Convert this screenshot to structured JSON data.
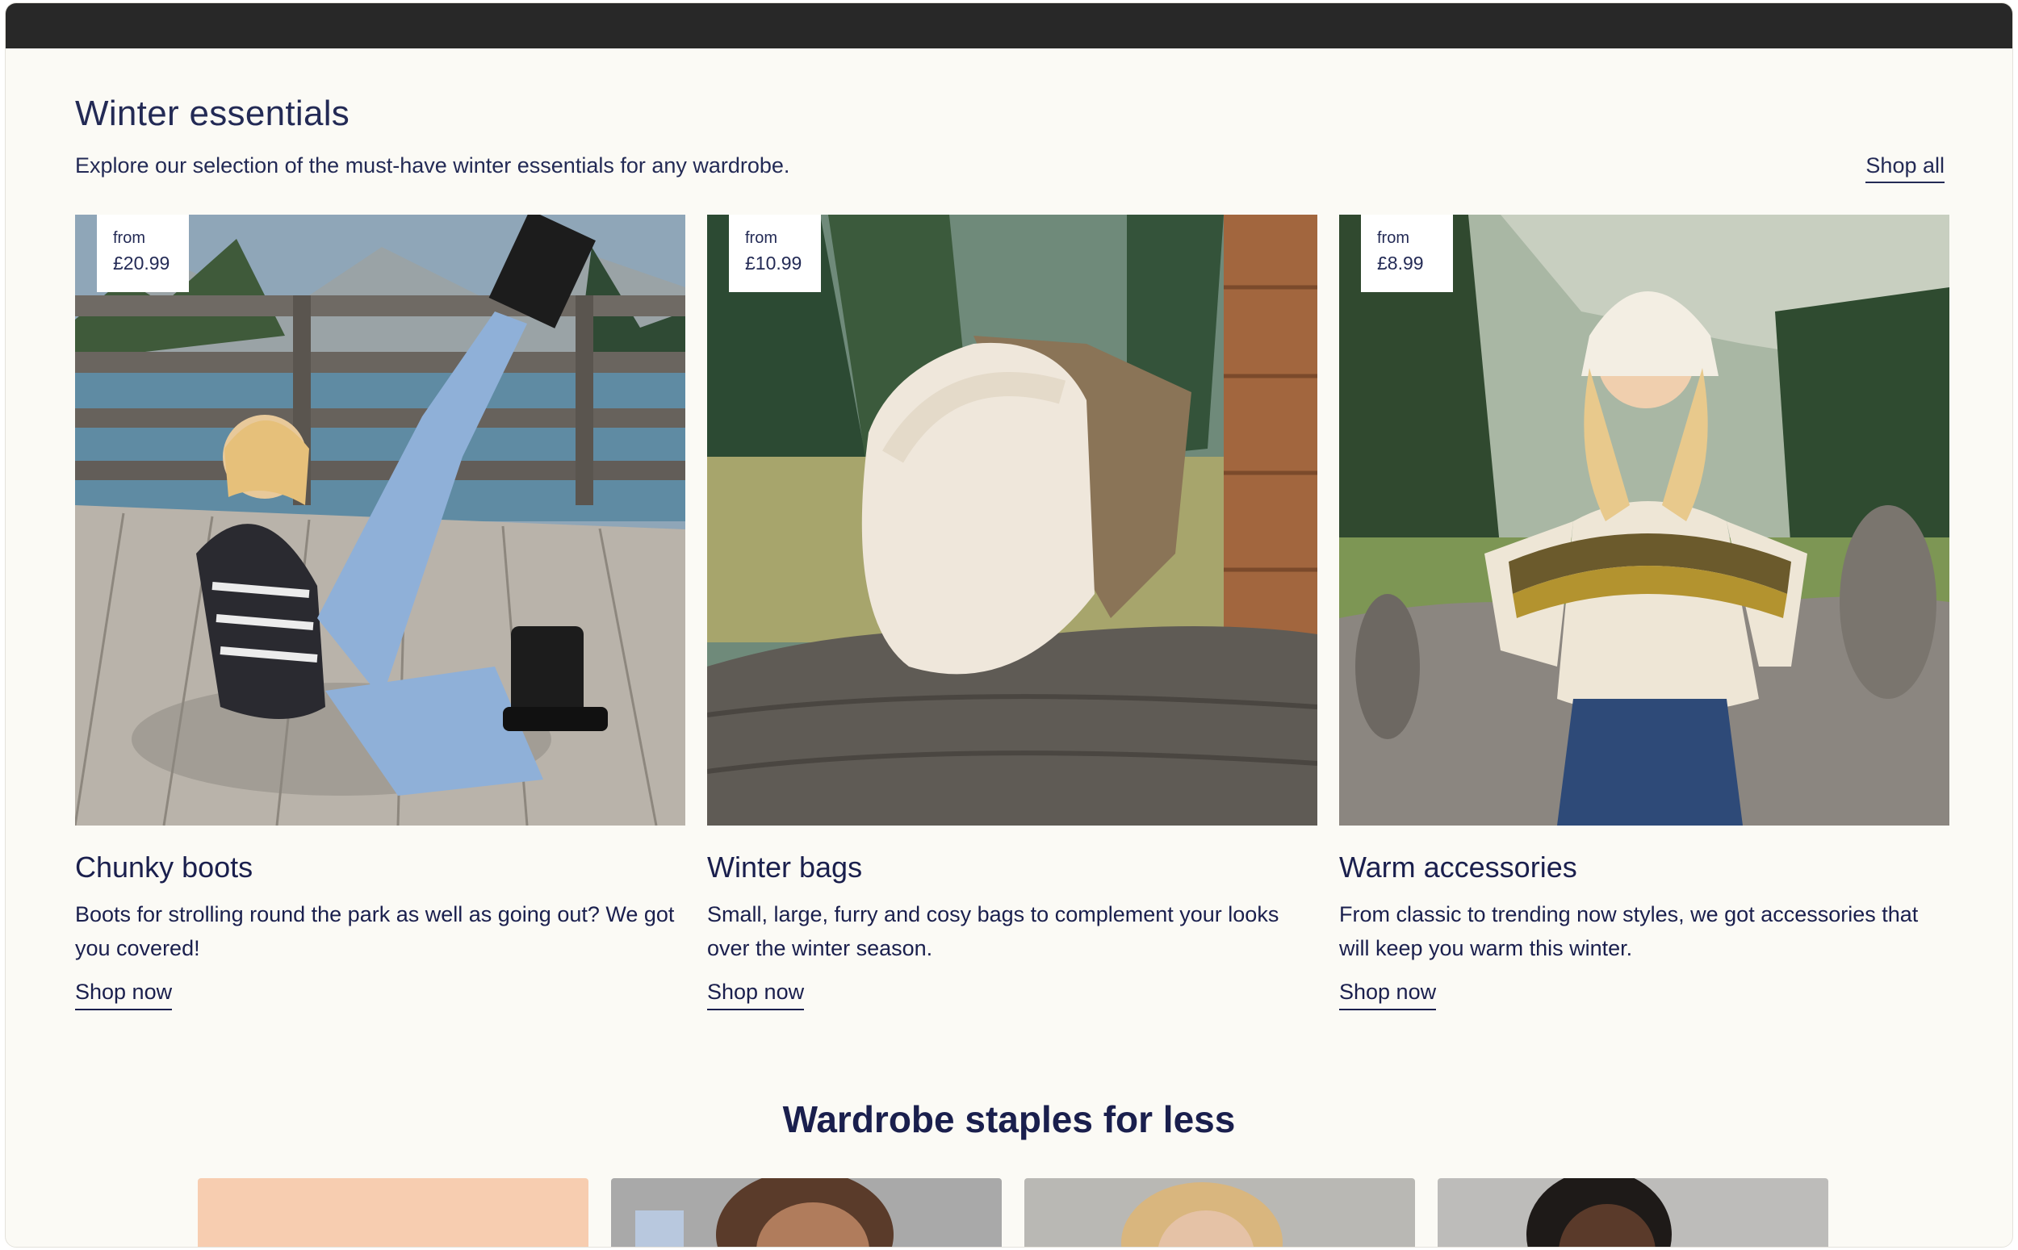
{
  "section": {
    "title": "Winter essentials",
    "subtitle": "Explore our selection of the must-have winter essentials for any wardrobe.",
    "shop_all_label": "Shop all"
  },
  "cards": [
    {
      "price_prefix": "from",
      "price": "£20.99",
      "title": "Chunky boots",
      "description": "Boots for strolling round the park as well as going out? We got you covered!",
      "link_label": "Shop now"
    },
    {
      "price_prefix": "from",
      "price": "£10.99",
      "title": "Winter bags",
      "description": "Small, large, furry and cosy bags to complement your looks over the winter season.",
      "link_label": "Shop now"
    },
    {
      "price_prefix": "from",
      "price": "£8.99",
      "title": "Warm accessories",
      "description": "From classic to trending now styles, we got accessories that will keep you warm this winter.",
      "link_label": "Shop now"
    }
  ],
  "staples": {
    "title": "Wardrobe staples for less"
  },
  "colors": {
    "text_navy": "#1a1f4d",
    "page_background": "#fbfaf5",
    "top_bar": "#282828",
    "price_tag_bg": "#ffffff",
    "staple_tile_peach": "#f7cdb0"
  }
}
